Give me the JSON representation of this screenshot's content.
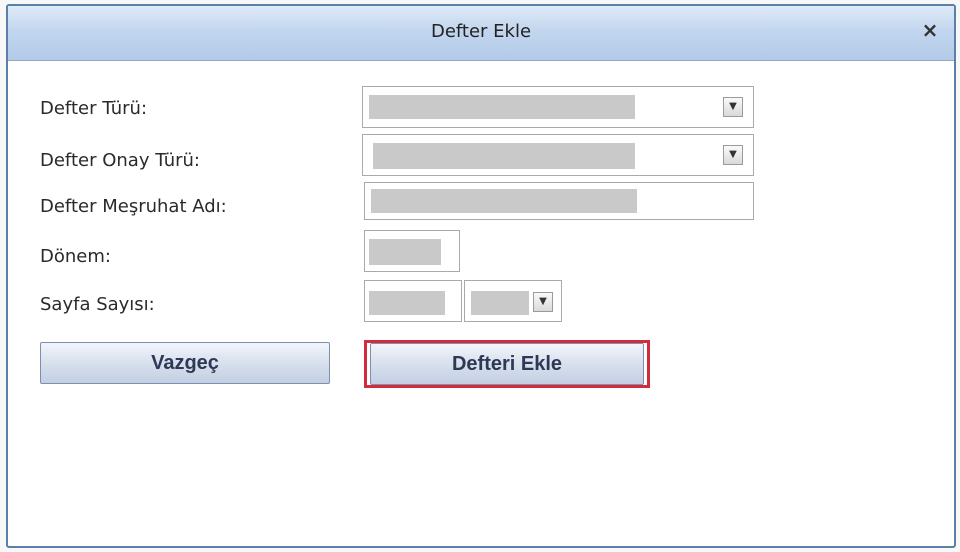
{
  "dialog": {
    "title": "Defter Ekle",
    "close_glyph": "×",
    "close_icon": "close-icon"
  },
  "form": {
    "defter_turu_label": "Defter Türü:",
    "defter_onay_turu_label": "Defter Onay Türü:",
    "defter_mesruhat_adi_label": "Defter Meşruhat Adı:",
    "donem_label": "Dönem:",
    "sayfa_sayisi_label": "Sayfa Sayısı:",
    "dropdown_glyph": "▼",
    "dropdown_icon": "chevron-down-icon"
  },
  "buttons": {
    "cancel_label": "Vazgeç",
    "add_label": "Defteri Ekle"
  },
  "colors": {
    "highlight": "#d12b3c",
    "titlebar": "#c2d6ee"
  }
}
